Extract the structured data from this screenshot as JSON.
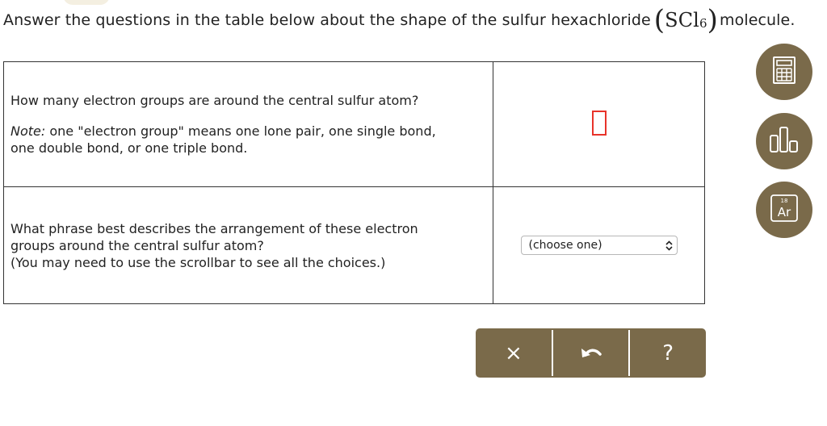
{
  "header": {
    "text_before": "Answer the questions in the table below about the shape of the sulfur hexachloride",
    "formula_base": "SCl",
    "formula_sub": "6",
    "text_after": "molecule."
  },
  "questions": [
    {
      "text": "How many electron groups are around the central sulfur atom?",
      "note_label": "Note:",
      "note_text": " one \"electron group\" means one lone pair, one single bond,",
      "note_text2": "one double bond, or one triple bond.",
      "answer_value": ""
    },
    {
      "line1": "What phrase best describes the arrangement of these electron",
      "line2": "groups around the central sulfur atom?",
      "line3": "(You may need to use the scrollbar to see all the choices.)",
      "select_value": "(choose one)"
    }
  ],
  "tools": [
    {
      "icon": "calculator-icon"
    },
    {
      "icon": "bar-chart-icon"
    },
    {
      "icon": "periodic-table-icon",
      "number": "18",
      "symbol": "Ar"
    }
  ],
  "actions": {
    "clear": "×",
    "undo_icon": "undo-icon",
    "help": "?"
  },
  "colors": {
    "accent": "#7a6a4a",
    "answer_border": "#e8332a"
  }
}
